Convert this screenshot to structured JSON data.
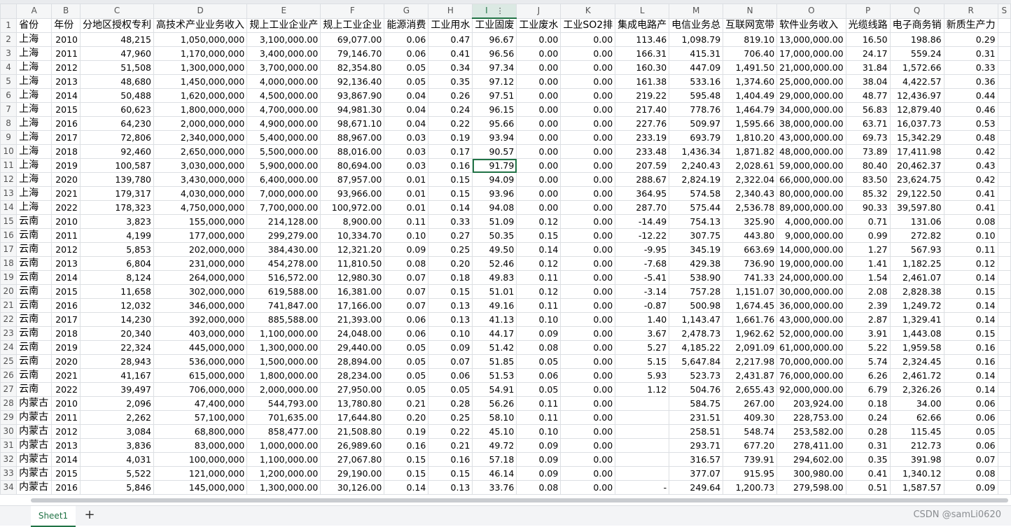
{
  "colors": {
    "accent": "#217346",
    "header_bg": "#f5f6f7",
    "gridline": "#dcdfe3"
  },
  "grid": {
    "columns": [
      "A",
      "B",
      "C",
      "D",
      "E",
      "F",
      "G",
      "H",
      "I",
      "J",
      "K",
      "L",
      "M",
      "N",
      "O",
      "P",
      "Q",
      "R",
      "S"
    ],
    "active_column": "I",
    "selected_cell": {
      "row": 11,
      "col": "I"
    },
    "col_menu_glyph": "⋮",
    "headers": [
      "省份",
      "年份",
      "分地区授权专利",
      "高技术产业业务收入",
      "规上工业企业产",
      "规上工业企业",
      "能源消费",
      "工业用水",
      "工业固废",
      "工业废水",
      "工业SO2排",
      "集成电路产",
      "电信业务总",
      "互联网宽带",
      "软件业务收入",
      "光缆线路",
      "电子商务销",
      "新质生产力",
      ""
    ],
    "rows": [
      [
        "上海",
        "2010",
        "48,215",
        "1,050,000,000",
        "3,100,000.00",
        "69,077.00",
        "0.06",
        "0.47",
        "96.67",
        "0.00",
        "0.00",
        "113.46",
        "1,098.79",
        "819.10",
        "13,000,000.00",
        "16.50",
        "198.86",
        "0.29"
      ],
      [
        "上海",
        "2011",
        "47,960",
        "1,170,000,000",
        "3,400,000.00",
        "79,146.70",
        "0.06",
        "0.41",
        "96.56",
        "0.00",
        "0.00",
        "166.31",
        "415.31",
        "706.40",
        "17,000,000.00",
        "24.17",
        "559.24",
        "0.31"
      ],
      [
        "上海",
        "2012",
        "51,508",
        "1,300,000,000",
        "3,700,000.00",
        "82,354.80",
        "0.05",
        "0.34",
        "97.34",
        "0.00",
        "0.00",
        "160.30",
        "447.09",
        "1,491.50",
        "21,000,000.00",
        "31.84",
        "1,572.66",
        "0.33"
      ],
      [
        "上海",
        "2013",
        "48,680",
        "1,450,000,000",
        "4,000,000.00",
        "92,136.40",
        "0.05",
        "0.35",
        "97.12",
        "0.00",
        "0.00",
        "161.38",
        "533.16",
        "1,374.60",
        "25,000,000.00",
        "38.04",
        "4,422.57",
        "0.36"
      ],
      [
        "上海",
        "2014",
        "50,488",
        "1,620,000,000",
        "4,500,000.00",
        "93,867.90",
        "0.04",
        "0.26",
        "97.51",
        "0.00",
        "0.00",
        "219.22",
        "595.48",
        "1,404.49",
        "29,000,000.00",
        "48.77",
        "12,436.97",
        "0.44"
      ],
      [
        "上海",
        "2015",
        "60,623",
        "1,800,000,000",
        "4,700,000.00",
        "94,981.30",
        "0.04",
        "0.24",
        "96.15",
        "0.00",
        "0.00",
        "217.40",
        "778.76",
        "1,464.79",
        "34,000,000.00",
        "56.83",
        "12,879.40",
        "0.46"
      ],
      [
        "上海",
        "2016",
        "64,230",
        "2,000,000,000",
        "4,900,000.00",
        "98,671.10",
        "0.04",
        "0.22",
        "95.66",
        "0.00",
        "0.00",
        "227.76",
        "509.97",
        "1,595.66",
        "38,000,000.00",
        "63.71",
        "16,037.73",
        "0.53"
      ],
      [
        "上海",
        "2017",
        "72,806",
        "2,340,000,000",
        "5,400,000.00",
        "88,967.00",
        "0.03",
        "0.19",
        "93.94",
        "0.00",
        "0.00",
        "233.19",
        "693.79",
        "1,810.20",
        "43,000,000.00",
        "69.73",
        "15,342.29",
        "0.48"
      ],
      [
        "上海",
        "2018",
        "92,460",
        "2,650,000,000",
        "5,500,000.00",
        "88,016.00",
        "0.03",
        "0.17",
        "90.57",
        "0.00",
        "0.00",
        "233.48",
        "1,436.34",
        "1,871.82",
        "48,000,000.00",
        "73.89",
        "17,411.98",
        "0.42"
      ],
      [
        "上海",
        "2019",
        "100,587",
        "3,030,000,000",
        "5,900,000.00",
        "80,694.00",
        "0.03",
        "0.16",
        "91.79",
        "0.00",
        "0.00",
        "207.59",
        "2,240.43",
        "2,028.61",
        "59,000,000.00",
        "80.40",
        "20,462.37",
        "0.43"
      ],
      [
        "上海",
        "2020",
        "139,780",
        "3,430,000,000",
        "6,400,000.00",
        "87,957.00",
        "0.01",
        "0.15",
        "94.09",
        "0.00",
        "0.00",
        "288.67",
        "2,824.19",
        "2,322.04",
        "66,000,000.00",
        "83.50",
        "23,624.75",
        "0.42"
      ],
      [
        "上海",
        "2021",
        "179,317",
        "4,030,000,000",
        "7,000,000.00",
        "93,966.00",
        "0.01",
        "0.15",
        "93.96",
        "0.00",
        "0.00",
        "364.95",
        "574.58",
        "2,340.43",
        "80,000,000.00",
        "85.32",
        "29,122.50",
        "0.41"
      ],
      [
        "上海",
        "2022",
        "178,323",
        "4,750,000,000",
        "7,700,000.00",
        "100,972.00",
        "0.01",
        "0.14",
        "94.08",
        "0.00",
        "0.00",
        "287.70",
        "575.44",
        "2,536.78",
        "89,000,000.00",
        "90.33",
        "39,597.80",
        "0.41"
      ],
      [
        "云南",
        "2010",
        "3,823",
        "155,000,000",
        "214,128.00",
        "8,900.00",
        "0.11",
        "0.33",
        "51.09",
        "0.12",
        "0.00",
        "-14.49",
        "754.13",
        "325.90",
        "4,000,000.00",
        "0.71",
        "131.06",
        "0.08"
      ],
      [
        "云南",
        "2011",
        "4,199",
        "177,000,000",
        "299,279.00",
        "10,334.70",
        "0.10",
        "0.27",
        "50.35",
        "0.15",
        "0.00",
        "-12.22",
        "307.75",
        "443.80",
        "9,000,000.00",
        "0.99",
        "272.82",
        "0.10"
      ],
      [
        "云南",
        "2012",
        "5,853",
        "202,000,000",
        "384,430.00",
        "12,321.20",
        "0.09",
        "0.25",
        "49.50",
        "0.14",
        "0.00",
        "-9.95",
        "345.19",
        "663.69",
        "14,000,000.00",
        "1.27",
        "567.93",
        "0.11"
      ],
      [
        "云南",
        "2013",
        "6,804",
        "231,000,000",
        "454,278.00",
        "11,810.50",
        "0.08",
        "0.20",
        "52.46",
        "0.12",
        "0.00",
        "-7.68",
        "429.38",
        "736.90",
        "19,000,000.00",
        "1.41",
        "1,182.25",
        "0.12"
      ],
      [
        "云南",
        "2014",
        "8,124",
        "264,000,000",
        "516,572.00",
        "12,980.30",
        "0.07",
        "0.18",
        "49.83",
        "0.11",
        "0.00",
        "-5.41",
        "538.90",
        "741.33",
        "24,000,000.00",
        "1.54",
        "2,461.07",
        "0.14"
      ],
      [
        "云南",
        "2015",
        "11,658",
        "302,000,000",
        "619,588.00",
        "16,381.00",
        "0.07",
        "0.15",
        "51.01",
        "0.12",
        "0.00",
        "-3.14",
        "757.28",
        "1,151.07",
        "30,000,000.00",
        "2.08",
        "2,828.38",
        "0.15"
      ],
      [
        "云南",
        "2016",
        "12,032",
        "346,000,000",
        "741,847.00",
        "17,166.00",
        "0.07",
        "0.13",
        "49.16",
        "0.11",
        "0.00",
        "-0.87",
        "500.98",
        "1,674.45",
        "36,000,000.00",
        "2.39",
        "1,249.72",
        "0.14"
      ],
      [
        "云南",
        "2017",
        "14,230",
        "392,000,000",
        "885,588.00",
        "21,393.00",
        "0.06",
        "0.13",
        "41.13",
        "0.10",
        "0.00",
        "1.40",
        "1,143.47",
        "1,661.76",
        "43,000,000.00",
        "2.87",
        "1,329.41",
        "0.14"
      ],
      [
        "云南",
        "2018",
        "20,340",
        "403,000,000",
        "1,100,000.00",
        "24,048.00",
        "0.06",
        "0.10",
        "44.17",
        "0.09",
        "0.00",
        "3.67",
        "2,478.73",
        "1,962.62",
        "52,000,000.00",
        "3.91",
        "1,443.08",
        "0.15"
      ],
      [
        "云南",
        "2019",
        "22,324",
        "445,000,000",
        "1,300,000.00",
        "29,440.00",
        "0.05",
        "0.09",
        "51.42",
        "0.08",
        "0.00",
        "5.27",
        "4,185.22",
        "2,091.09",
        "61,000,000.00",
        "5.22",
        "1,959.58",
        "0.16"
      ],
      [
        "云南",
        "2020",
        "28,943",
        "536,000,000",
        "1,500,000.00",
        "28,894.00",
        "0.05",
        "0.07",
        "51.85",
        "0.05",
        "0.00",
        "5.15",
        "5,647.84",
        "2,217.98",
        "70,000,000.00",
        "5.74",
        "2,324.45",
        "0.16"
      ],
      [
        "云南",
        "2021",
        "41,167",
        "615,000,000",
        "1,800,000.00",
        "28,234.00",
        "0.05",
        "0.06",
        "51.53",
        "0.06",
        "0.00",
        "5.93",
        "523.73",
        "2,431.87",
        "76,000,000.00",
        "6.26",
        "2,461.72",
        "0.14"
      ],
      [
        "云南",
        "2022",
        "39,497",
        "706,000,000",
        "2,000,000.00",
        "27,950.00",
        "0.05",
        "0.05",
        "54.91",
        "0.05",
        "0.00",
        "1.12",
        "504.76",
        "2,655.43",
        "92,000,000.00",
        "6.79",
        "2,326.26",
        "0.14"
      ],
      [
        "内蒙古",
        "2010",
        "2,096",
        "47,400,000",
        "544,793.00",
        "13,780.80",
        "0.21",
        "0.28",
        "56.26",
        "0.11",
        "0.00",
        "",
        "584.75",
        "267.00",
        "203,924.00",
        "0.18",
        "34.00",
        "0.06"
      ],
      [
        "内蒙古",
        "2011",
        "2,262",
        "57,100,000",
        "701,635.00",
        "17,644.80",
        "0.20",
        "0.25",
        "58.10",
        "0.11",
        "0.00",
        "",
        "231.51",
        "409.30",
        "228,753.00",
        "0.24",
        "62.66",
        "0.06"
      ],
      [
        "内蒙古",
        "2012",
        "3,084",
        "68,800,000",
        "858,477.00",
        "21,508.80",
        "0.19",
        "0.22",
        "45.10",
        "0.10",
        "0.00",
        "",
        "258.51",
        "548.74",
        "253,582.00",
        "0.28",
        "115.45",
        "0.05"
      ],
      [
        "内蒙古",
        "2013",
        "3,836",
        "83,000,000",
        "1,000,000.00",
        "26,989.60",
        "0.16",
        "0.21",
        "49.72",
        "0.09",
        "0.00",
        "",
        "293.71",
        "677.20",
        "278,411.00",
        "0.31",
        "212.73",
        "0.06"
      ],
      [
        "内蒙古",
        "2014",
        "4,031",
        "100,000,000",
        "1,100,000.00",
        "27,067.80",
        "0.15",
        "0.16",
        "57.18",
        "0.09",
        "0.00",
        "",
        "316.57",
        "739.91",
        "294,602.00",
        "0.35",
        "391.98",
        "0.07"
      ],
      [
        "内蒙古",
        "2015",
        "5,522",
        "121,000,000",
        "1,200,000.00",
        "29,190.00",
        "0.15",
        "0.15",
        "46.14",
        "0.09",
        "0.00",
        "",
        "377.07",
        "915.95",
        "300,980.00",
        "0.41",
        "1,340.12",
        "0.08"
      ],
      [
        "内蒙古",
        "2016",
        "5,846",
        "145,000,000",
        "1,300,000.00",
        "30,126.00",
        "0.14",
        "0.13",
        "33.76",
        "0.08",
        "0.00",
        "-",
        "249.64",
        "1,200.73",
        "279,598.00",
        "0.51",
        "1,587.57",
        "0.09"
      ]
    ]
  },
  "sheet_tabs": [
    {
      "label": "Sheet1"
    }
  ],
  "add_sheet_label": "+",
  "watermark": "CSDN @samLi0620"
}
